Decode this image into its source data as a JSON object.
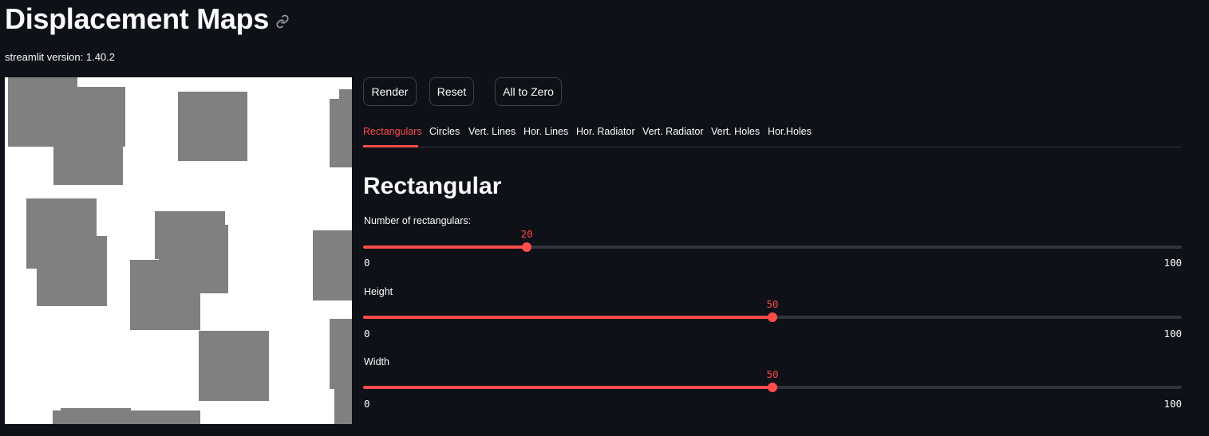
{
  "page": {
    "title": "Displacement Maps",
    "link_icon": "link-icon",
    "version": "streamlit version: 1.40.2"
  },
  "buttons": {
    "render": "Render",
    "reset": "Reset",
    "all_to_zero": "All to Zero"
  },
  "tabs": [
    {
      "label": "Rectangulars",
      "active": true
    },
    {
      "label": "Circles",
      "active": false
    },
    {
      "label": "Vert. Lines",
      "active": false
    },
    {
      "label": "Hor. Lines",
      "active": false
    },
    {
      "label": "Hor. Radiator",
      "active": false
    },
    {
      "label": "Vert. Radiator",
      "active": false
    },
    {
      "label": "Vert. Holes",
      "active": false
    },
    {
      "label": "Hor.Holes",
      "active": false
    }
  ],
  "section": {
    "title": "Rectangular"
  },
  "sliders": [
    {
      "label": "Number of rectangulars:",
      "value": 20,
      "min": 0,
      "max": 100
    },
    {
      "label": "Height",
      "value": 50,
      "min": 0,
      "max": 100
    },
    {
      "label": "Width",
      "value": 50,
      "min": 0,
      "max": 100
    }
  ],
  "colors": {
    "background": "#0e1117",
    "accent": "#ff4b4b",
    "canvas_background": "#ffffff",
    "rectangle_fill": "#808080"
  }
}
